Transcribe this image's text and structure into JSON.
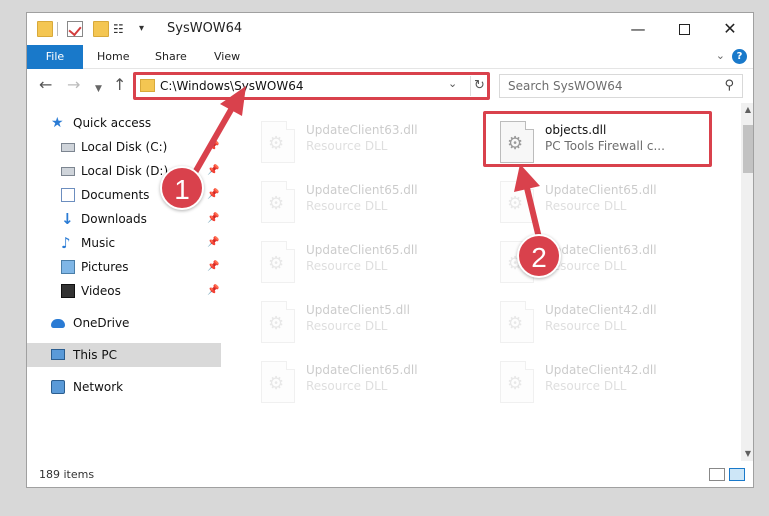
{
  "window": {
    "title": "SysWOW64",
    "min_glyph": "—",
    "close_glyph": "✕"
  },
  "ribbon": {
    "tabs": [
      "File",
      "Home",
      "Share",
      "View"
    ],
    "help_glyph": "?",
    "collapse_glyph": "⌄"
  },
  "nav": {
    "back_glyph": "←",
    "forward_glyph": "→",
    "recent_glyph": "▼",
    "up_glyph": "↑",
    "address": "C:\\Windows\\SysWOW64",
    "dropdown_glyph": "⌄",
    "refresh_glyph": "↻",
    "search_placeholder": "Search SysWOW64",
    "search_glyph": "⚲"
  },
  "sidebar": {
    "pin_glyph": "📌",
    "items": [
      {
        "label": "Quick access",
        "icon": "star-icon"
      },
      {
        "label": "Local Disk (C:)",
        "icon": "disk-icon"
      },
      {
        "label": "Local Disk (D:)",
        "icon": "disk-icon"
      },
      {
        "label": "Documents",
        "icon": "documents-icon"
      },
      {
        "label": "Downloads",
        "icon": "download-icon"
      },
      {
        "label": "Music",
        "icon": "music-icon"
      },
      {
        "label": "Pictures",
        "icon": "pictures-icon"
      },
      {
        "label": "Videos",
        "icon": "videos-icon"
      },
      {
        "label": "OneDrive",
        "icon": "onedrive-icon"
      },
      {
        "label": "This PC",
        "icon": "computer-icon"
      },
      {
        "label": "Network",
        "icon": "network-icon"
      }
    ],
    "selected": "This PC"
  },
  "files": [
    {
      "name": "UpdateClient63.dll",
      "desc": "Resource DLL"
    },
    {
      "name": "objects.dll",
      "desc": "PC Tools Firewall c..."
    },
    {
      "name": "UpdateClient65.dll",
      "desc": "Resource DLL"
    },
    {
      "name": "UpdateClient65.dll",
      "desc": "Resource DLL"
    },
    {
      "name": "UpdateClient65.dll",
      "desc": "Resource DLL"
    },
    {
      "name": "UpdateClient63.dll",
      "desc": "Resource DLL"
    },
    {
      "name": "UpdateClient5.dll",
      "desc": "Resource DLL"
    },
    {
      "name": "UpdateClient42.dll",
      "desc": "Resource DLL"
    },
    {
      "name": "UpdateClient65.dll",
      "desc": "Resource DLL"
    },
    {
      "name": "UpdateClient42.dll",
      "desc": "Resource DLL"
    }
  ],
  "status": {
    "item_count": "189 items"
  },
  "callouts": [
    "1",
    "2"
  ],
  "colors": {
    "accent": "#1979ca",
    "callout": "#d9414c"
  }
}
